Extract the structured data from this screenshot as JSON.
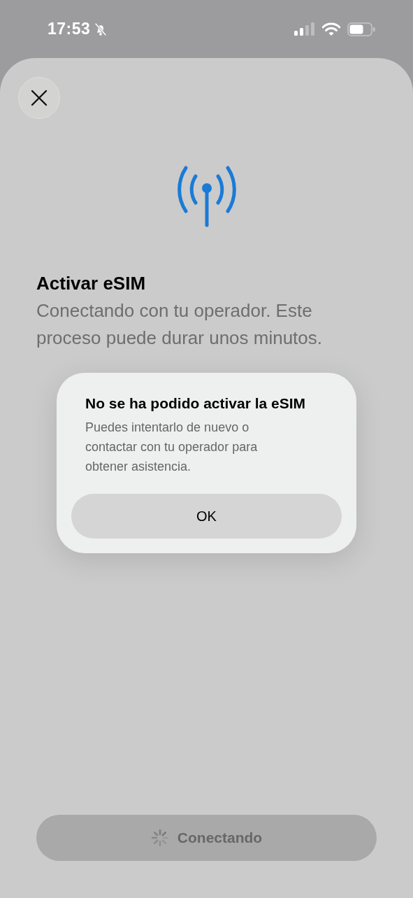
{
  "status_bar": {
    "time": "17:53",
    "silent": true
  },
  "sheet": {
    "title": "Activar eSIM",
    "subtitle": "Conectando con tu operador. Este proceso puede durar unos minutos.",
    "button": {
      "label": "Conectando",
      "disabled": true
    }
  },
  "alert": {
    "title": "No se ha podido activar la eSIM",
    "message": "Puedes intentarlo de nuevo o contactar con tu operador para obtener asistencia.",
    "buttons": [
      "OK"
    ]
  }
}
